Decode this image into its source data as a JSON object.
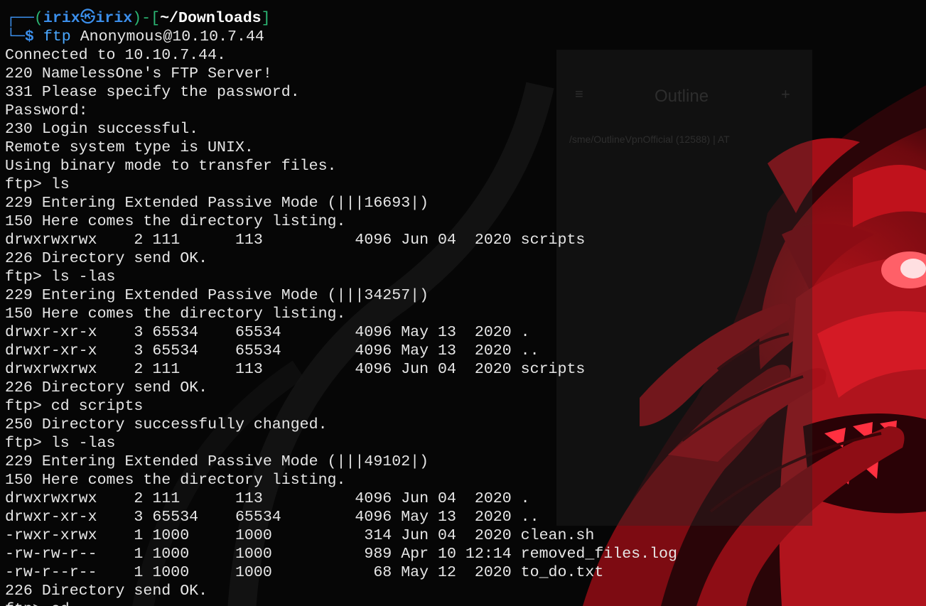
{
  "prompt": {
    "box_top": "┌──",
    "box_bottom": "└─",
    "open_paren": "(",
    "user": "irix",
    "at_symbol": "㉿",
    "host": "irix",
    "close_paren": ")",
    "dash": "-",
    "open_bracket": "[",
    "cwd": "~/Downloads",
    "close_bracket": "]",
    "dollar": "$",
    "command": "ftp",
    "command_args": "Anonymous@10.10.7.44"
  },
  "output_lines": [
    "Connected to 10.10.7.44.",
    "220 NamelessOne's FTP Server!",
    "331 Please specify the password.",
    "Password:",
    "230 Login successful.",
    "Remote system type is UNIX.",
    "Using binary mode to transfer files.",
    "ftp> ls",
    "229 Entering Extended Passive Mode (|||16693|)",
    "150 Here comes the directory listing.",
    "drwxrwxrwx    2 111      113          4096 Jun 04  2020 scripts",
    "226 Directory send OK.",
    "ftp> ls -las",
    "229 Entering Extended Passive Mode (|||34257|)",
    "150 Here comes the directory listing.",
    "drwxr-xr-x    3 65534    65534        4096 May 13  2020 .",
    "drwxr-xr-x    3 65534    65534        4096 May 13  2020 ..",
    "drwxrwxrwx    2 111      113          4096 Jun 04  2020 scripts",
    "226 Directory send OK.",
    "ftp> cd scripts",
    "250 Directory successfully changed.",
    "ftp> ls -las",
    "229 Entering Extended Passive Mode (|||49102|)",
    "150 Here comes the directory listing.",
    "drwxrwxrwx    2 111      113          4096 Jun 04  2020 .",
    "drwxr-xr-x    3 65534    65534        4096 May 13  2020 ..",
    "-rwxr-xrwx    1 1000     1000          314 Jun 04  2020 clean.sh",
    "-rw-rw-r--    1 1000     1000          989 Apr 10 12:14 removed_files.log",
    "-rw-r--r--    1 1000     1000           68 May 12  2020 to_do.txt",
    "226 Directory send OK.",
    "ftp> cd .."
  ],
  "background_ghost": {
    "title": "Outline",
    "subtitle": "/sme/OutlineVpnOfficial (12588) | AT"
  },
  "colors": {
    "terminal_bg": "#060606",
    "text": "#e6e6e6",
    "prompt_blue": "#3b8eea",
    "prompt_green": "#2bb673",
    "wallpaper_red": "#c8101a"
  },
  "icons": {
    "background_menu": "hamburger-icon",
    "background_add": "plus-icon",
    "background_art": "red-demon-illustration"
  }
}
